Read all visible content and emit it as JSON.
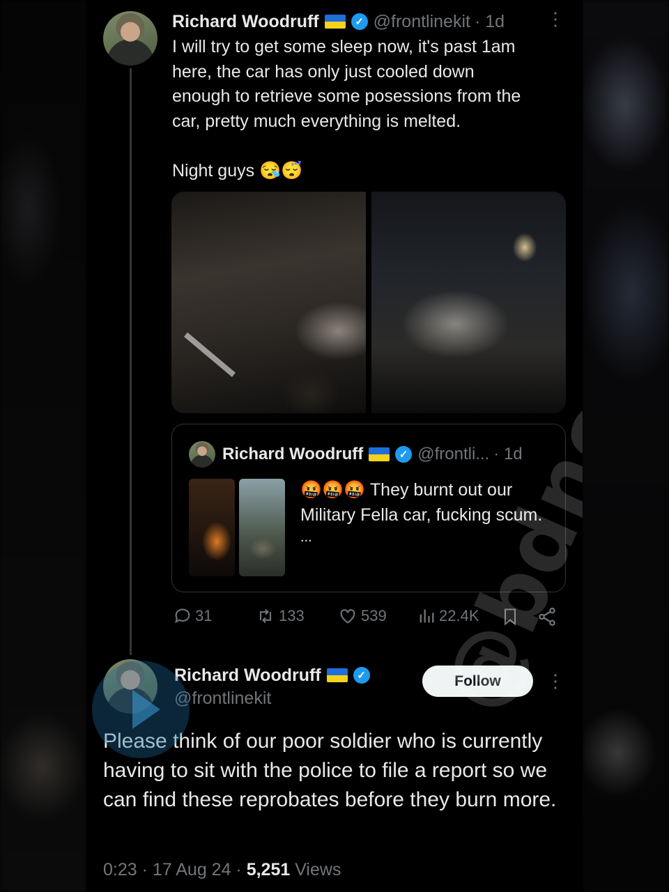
{
  "tweet1": {
    "name": "Richard Woodruff",
    "handle": "@frontlinekit",
    "time": "· 1d",
    "text_lines": [
      "I will try to get some sleep now, it's past 1am",
      "here, the car has only just cooled down",
      "enough to retrieve some posessions from the",
      "car, pretty much everything is melted.",
      "",
      "Night guys 😪😴"
    ]
  },
  "quoted": {
    "name": "Richard Woodruff",
    "handle": "@frontli...",
    "time": "· 1d",
    "emoji": "🤬🤬🤬",
    "text": "They burnt out our Military Fella car, fucking scum.",
    "more": "..."
  },
  "actions": {
    "replies": "31",
    "reposts": "133",
    "likes": "539",
    "views": "22.4K"
  },
  "tweet2": {
    "name": "Richard Woodruff",
    "handle": "@frontlinekit",
    "follow_label": "Follow",
    "text": "Please think of our poor soldier who is currently having to sit with the police to file a report so we can find these reprobates before they burn more.",
    "timestamp": "0:23 · 17 Aug 24 · ",
    "views_count": "5,251",
    "views_label": " Views"
  },
  "watermark": "@bdnoqtiqs",
  "colors": {
    "background": "#000000",
    "text": "#e7e9ea",
    "secondary": "#71767b",
    "verified": "#1d9bf0",
    "border": "#2f3336"
  },
  "icons": [
    "verified-badge-icon",
    "ukraine-flag-icon",
    "more-dots-icon",
    "reply-icon",
    "repost-icon",
    "like-icon",
    "views-icon",
    "bookmark-icon",
    "share-icon"
  ]
}
